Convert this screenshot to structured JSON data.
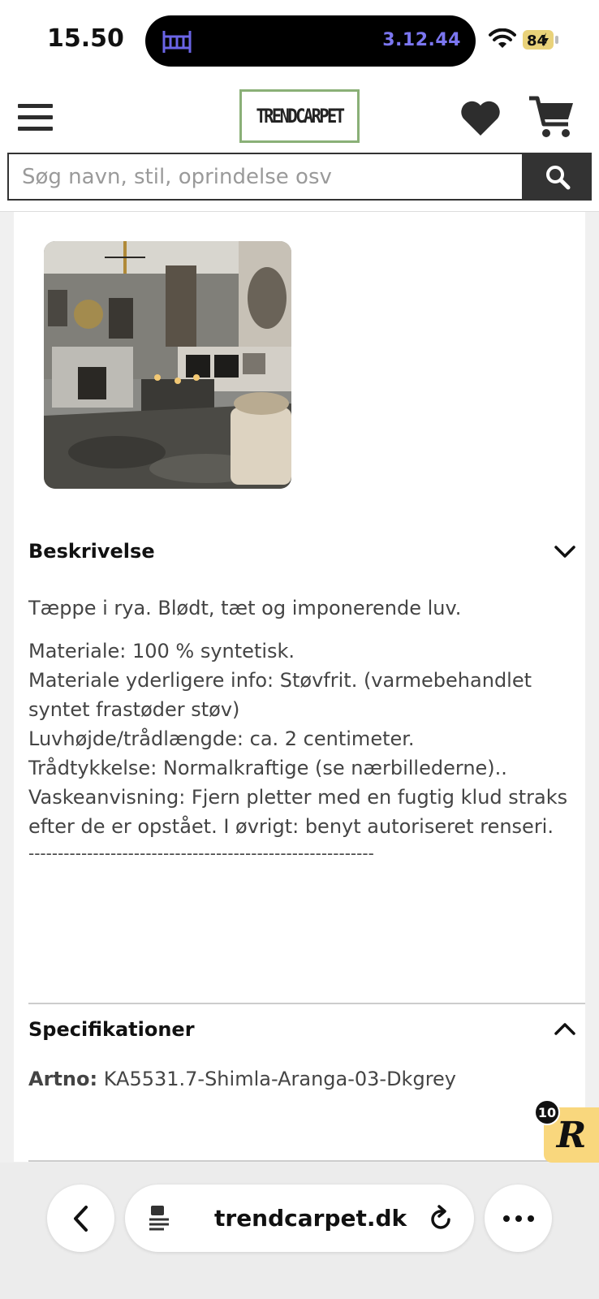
{
  "status_bar": {
    "time": "15.50",
    "timer": "3.12.44",
    "battery": "84"
  },
  "header": {
    "logo": "TRENDCARPET",
    "search_placeholder": "Søg navn, stil, oprindelse osv"
  },
  "description": {
    "title": "Beskrivelse",
    "intro": "Tæppe i rya. Blødt, tæt og imponerende luv.",
    "lines": [
      "Materiale: 100 % syntetisk.",
      "Materiale yderligere info: Støvfrit. (varmebehandlet syntet frastøder støv)",
      "Luvhøjde/trådlængde: ca. 2 centimeter.",
      "Trådtykkelse: Normalkraftige (se nærbillederne)..",
      "Vaskeanvisning: Fjern pletter med en fugtig klud straks efter de er opstået. I øvrigt: benyt autoriseret renseri.",
      "-----------------------------------------------------------"
    ]
  },
  "specifications": {
    "title": "Specifikationer",
    "artno_label": "Artno:",
    "artno_value": "KA5531.7-Shimla-Aranga-03-Dkgrey"
  },
  "review_badge": {
    "count": "10",
    "letter": "R"
  },
  "browser": {
    "url": "trendcarpet.dk"
  },
  "colors": {
    "logo_border": "#8ab077",
    "timer": "#7b76f0",
    "badge": "#f9d77d"
  }
}
